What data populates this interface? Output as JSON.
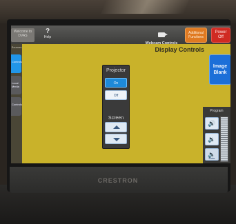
{
  "topbar": {
    "left_text": "Welcome to DVAS",
    "help_icon": "?",
    "help_label": "Help",
    "webcam_icon": "video-camera-icon",
    "webcam_label": "Webcam Controls",
    "additional_label": "Additional Functions",
    "power_label": "Power Off"
  },
  "page_title": "Display Controls",
  "left_nav": {
    "header": "Sources",
    "items": [
      {
        "label": "Controls",
        "state": "active"
      },
      {
        "label": "Local Media",
        "state": "inactive"
      },
      {
        "label": "Controls",
        "state": "inactive"
      }
    ]
  },
  "projector": {
    "title": "Projector",
    "on_label": "On",
    "off_label": "Off",
    "screen_title": "Screen",
    "up_icon": "arrow-up-icon",
    "down_icon": "arrow-down-icon"
  },
  "image_blank": {
    "label": "Image Blank"
  },
  "program": {
    "title": "Program",
    "volume_up_icon": "speaker-up-icon",
    "volume_down_icon": "speaker-down-icon",
    "mute_label": "Mute"
  },
  "device_brand": "CRESTRON",
  "colors": {
    "screen_bg": "#c9b22a",
    "active_blue": "#1e8ad8",
    "additional_orange": "#e07a22",
    "power_red": "#d02a22"
  }
}
